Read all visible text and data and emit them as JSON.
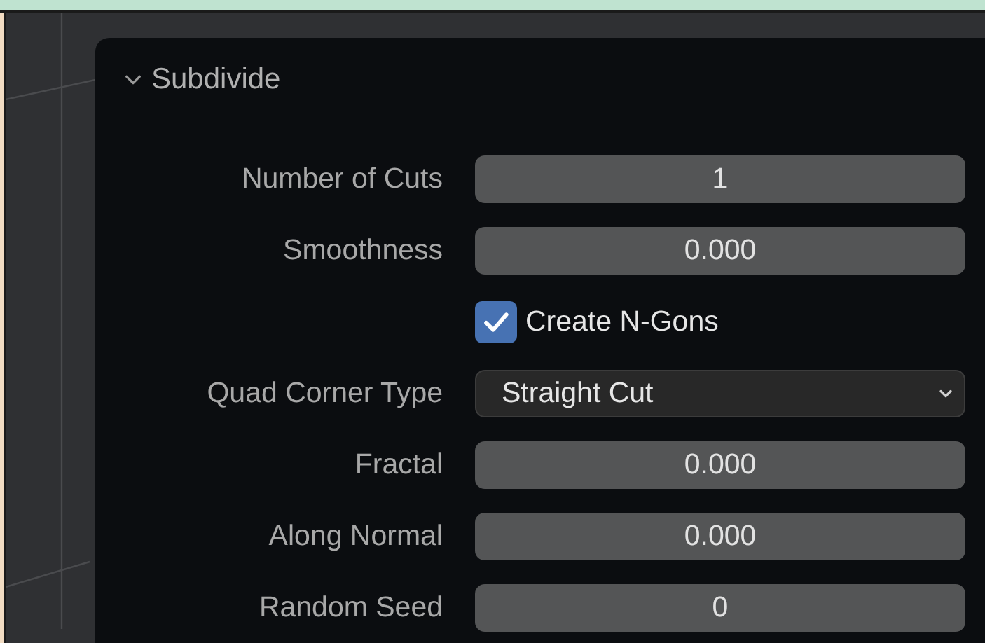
{
  "panel": {
    "title": "Subdivide",
    "expanded": true,
    "properties": [
      {
        "kind": "number",
        "label": "Number of Cuts",
        "value": "1"
      },
      {
        "kind": "number",
        "label": "Smoothness",
        "value": "0.000"
      },
      {
        "kind": "checkbox",
        "label": "Create N-Gons",
        "checked": true
      },
      {
        "kind": "dropdown",
        "label": "Quad Corner Type",
        "value": "Straight Cut"
      },
      {
        "kind": "number",
        "label": "Fractal",
        "value": "0.000"
      },
      {
        "kind": "number",
        "label": "Along Normal",
        "value": "0.000"
      },
      {
        "kind": "number",
        "label": "Random Seed",
        "value": "0"
      }
    ]
  }
}
